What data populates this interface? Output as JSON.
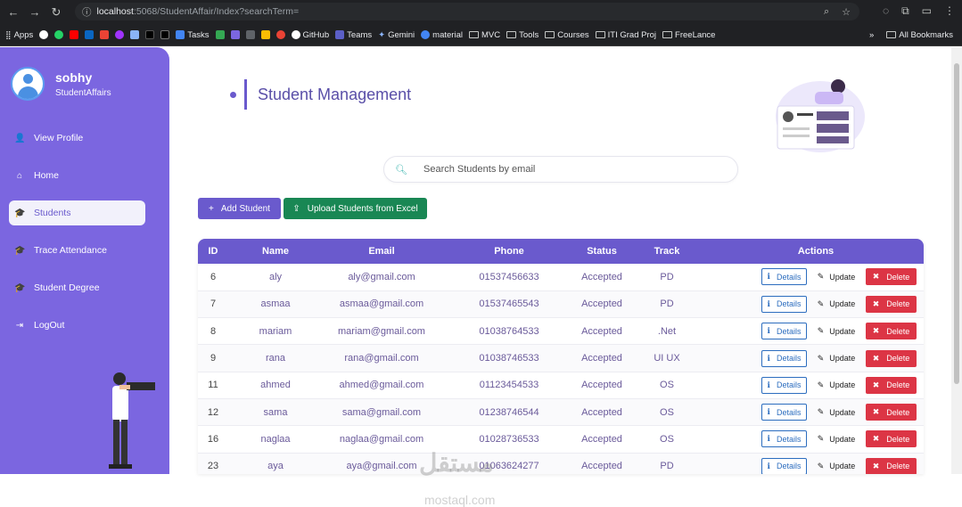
{
  "browser": {
    "url_host": "localhost",
    "url_path": ":5068/StudentAffair/Index?searchTerm=",
    "bookmarks": [
      "Apps",
      "Tasks",
      "GitHub",
      "Teams",
      "Gemini",
      "material",
      "MVC",
      "Tools",
      "Courses",
      "ITI Grad Proj",
      "FreeLance"
    ],
    "all_bookmarks": "All Bookmarks"
  },
  "sidebar": {
    "username": "sobhy",
    "role": "StudentAffairs",
    "items": [
      {
        "label": "View Profile",
        "icon": "user-edit-icon"
      },
      {
        "label": "Home",
        "icon": "home-icon"
      },
      {
        "label": "Students",
        "icon": "graduation-cap-icon",
        "active": true
      },
      {
        "label": "Trace Attendance",
        "icon": "graduation-cap-icon"
      },
      {
        "label": "Student Degree",
        "icon": "graduation-cap-icon"
      },
      {
        "label": "LogOut",
        "icon": "sign-out-icon"
      }
    ]
  },
  "main": {
    "title": "Student Management",
    "search_placeholder": "Search Students by email",
    "add_button": "Add Student",
    "upload_button": "Upload Students from Excel"
  },
  "table": {
    "headers": [
      "ID",
      "Name",
      "Email",
      "Phone",
      "Status",
      "Track",
      "Actions"
    ],
    "rows": [
      {
        "id": "6",
        "name": "aly",
        "email": "aly@gmail.com",
        "phone": "01537456633",
        "status": "Accepted",
        "track": "PD"
      },
      {
        "id": "7",
        "name": "asmaa",
        "email": "asmaa@gmail.com",
        "phone": "01537465543",
        "status": "Accepted",
        "track": "PD"
      },
      {
        "id": "8",
        "name": "mariam",
        "email": "mariam@gmail.com",
        "phone": "01038764533",
        "status": "Accepted",
        "track": ".Net"
      },
      {
        "id": "9",
        "name": "rana",
        "email": "rana@gmail.com",
        "phone": "01038746533",
        "status": "Accepted",
        "track": "UI UX"
      },
      {
        "id": "11",
        "name": "ahmed",
        "email": "ahmed@gmail.com",
        "phone": "01123454533",
        "status": "Accepted",
        "track": "OS"
      },
      {
        "id": "12",
        "name": "sama",
        "email": "sama@gmail.com",
        "phone": "01238746544",
        "status": "Accepted",
        "track": "OS"
      },
      {
        "id": "16",
        "name": "naglaa",
        "email": "naglaa@gmail.com",
        "phone": "01028736533",
        "status": "Accepted",
        "track": "OS"
      },
      {
        "id": "23",
        "name": "aya",
        "email": "aya@gmail.com",
        "phone": "01063624277",
        "status": "Accepted",
        "track": "PD"
      }
    ],
    "action_labels": {
      "details": "Details",
      "update": "Update",
      "delete": "Delete"
    }
  },
  "watermark": {
    "line1": "مستقل",
    "line2": "mostaql.com"
  },
  "colors": {
    "sidebar": "#7b66e0",
    "primary": "#6a5acd",
    "success": "#198754",
    "danger": "#dc3545"
  }
}
